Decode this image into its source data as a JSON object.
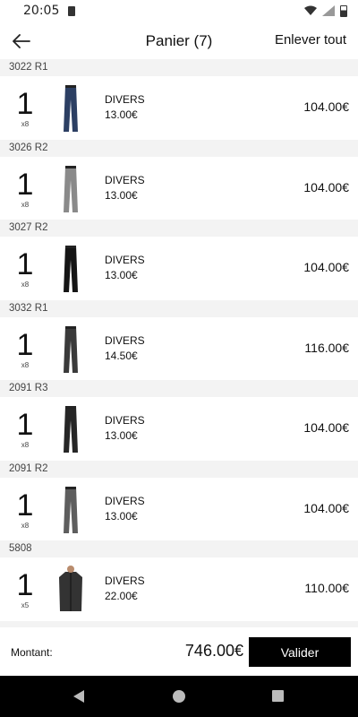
{
  "status_bar": {
    "time": "20:05"
  },
  "header": {
    "title": "Panier (7)",
    "clear_label": "Enlever tout"
  },
  "items": [
    {
      "ref": "3022 R1",
      "qty": "1",
      "sub": "x8",
      "brand": "DIVERS",
      "unit_price": "13.00€",
      "total": "104.00€",
      "color": "#2c3f63"
    },
    {
      "ref": "3026 R2",
      "qty": "1",
      "sub": "x8",
      "brand": "DIVERS",
      "unit_price": "13.00€",
      "total": "104.00€",
      "color": "#8a8a8a"
    },
    {
      "ref": "3027 R2",
      "qty": "1",
      "sub": "x8",
      "brand": "DIVERS",
      "unit_price": "13.00€",
      "total": "104.00€",
      "color": "#151515"
    },
    {
      "ref": "3032 R1",
      "qty": "1",
      "sub": "x8",
      "brand": "DIVERS",
      "unit_price": "14.50€",
      "total": "116.00€",
      "color": "#3a3a3a"
    },
    {
      "ref": "2091 R3",
      "qty": "1",
      "sub": "x8",
      "brand": "DIVERS",
      "unit_price": "13.00€",
      "total": "104.00€",
      "color": "#262626"
    },
    {
      "ref": "2091 R2",
      "qty": "1",
      "sub": "x8",
      "brand": "DIVERS",
      "unit_price": "13.00€",
      "total": "104.00€",
      "color": "#5e5e5e"
    },
    {
      "ref": "5808",
      "qty": "1",
      "sub": "x5",
      "brand": "DIVERS",
      "unit_price": "22.00€",
      "total": "110.00€",
      "color": "#333333"
    }
  ],
  "footer": {
    "amount_label": "Montant:",
    "amount_value": "746.00€",
    "validate_label": "Valider"
  }
}
